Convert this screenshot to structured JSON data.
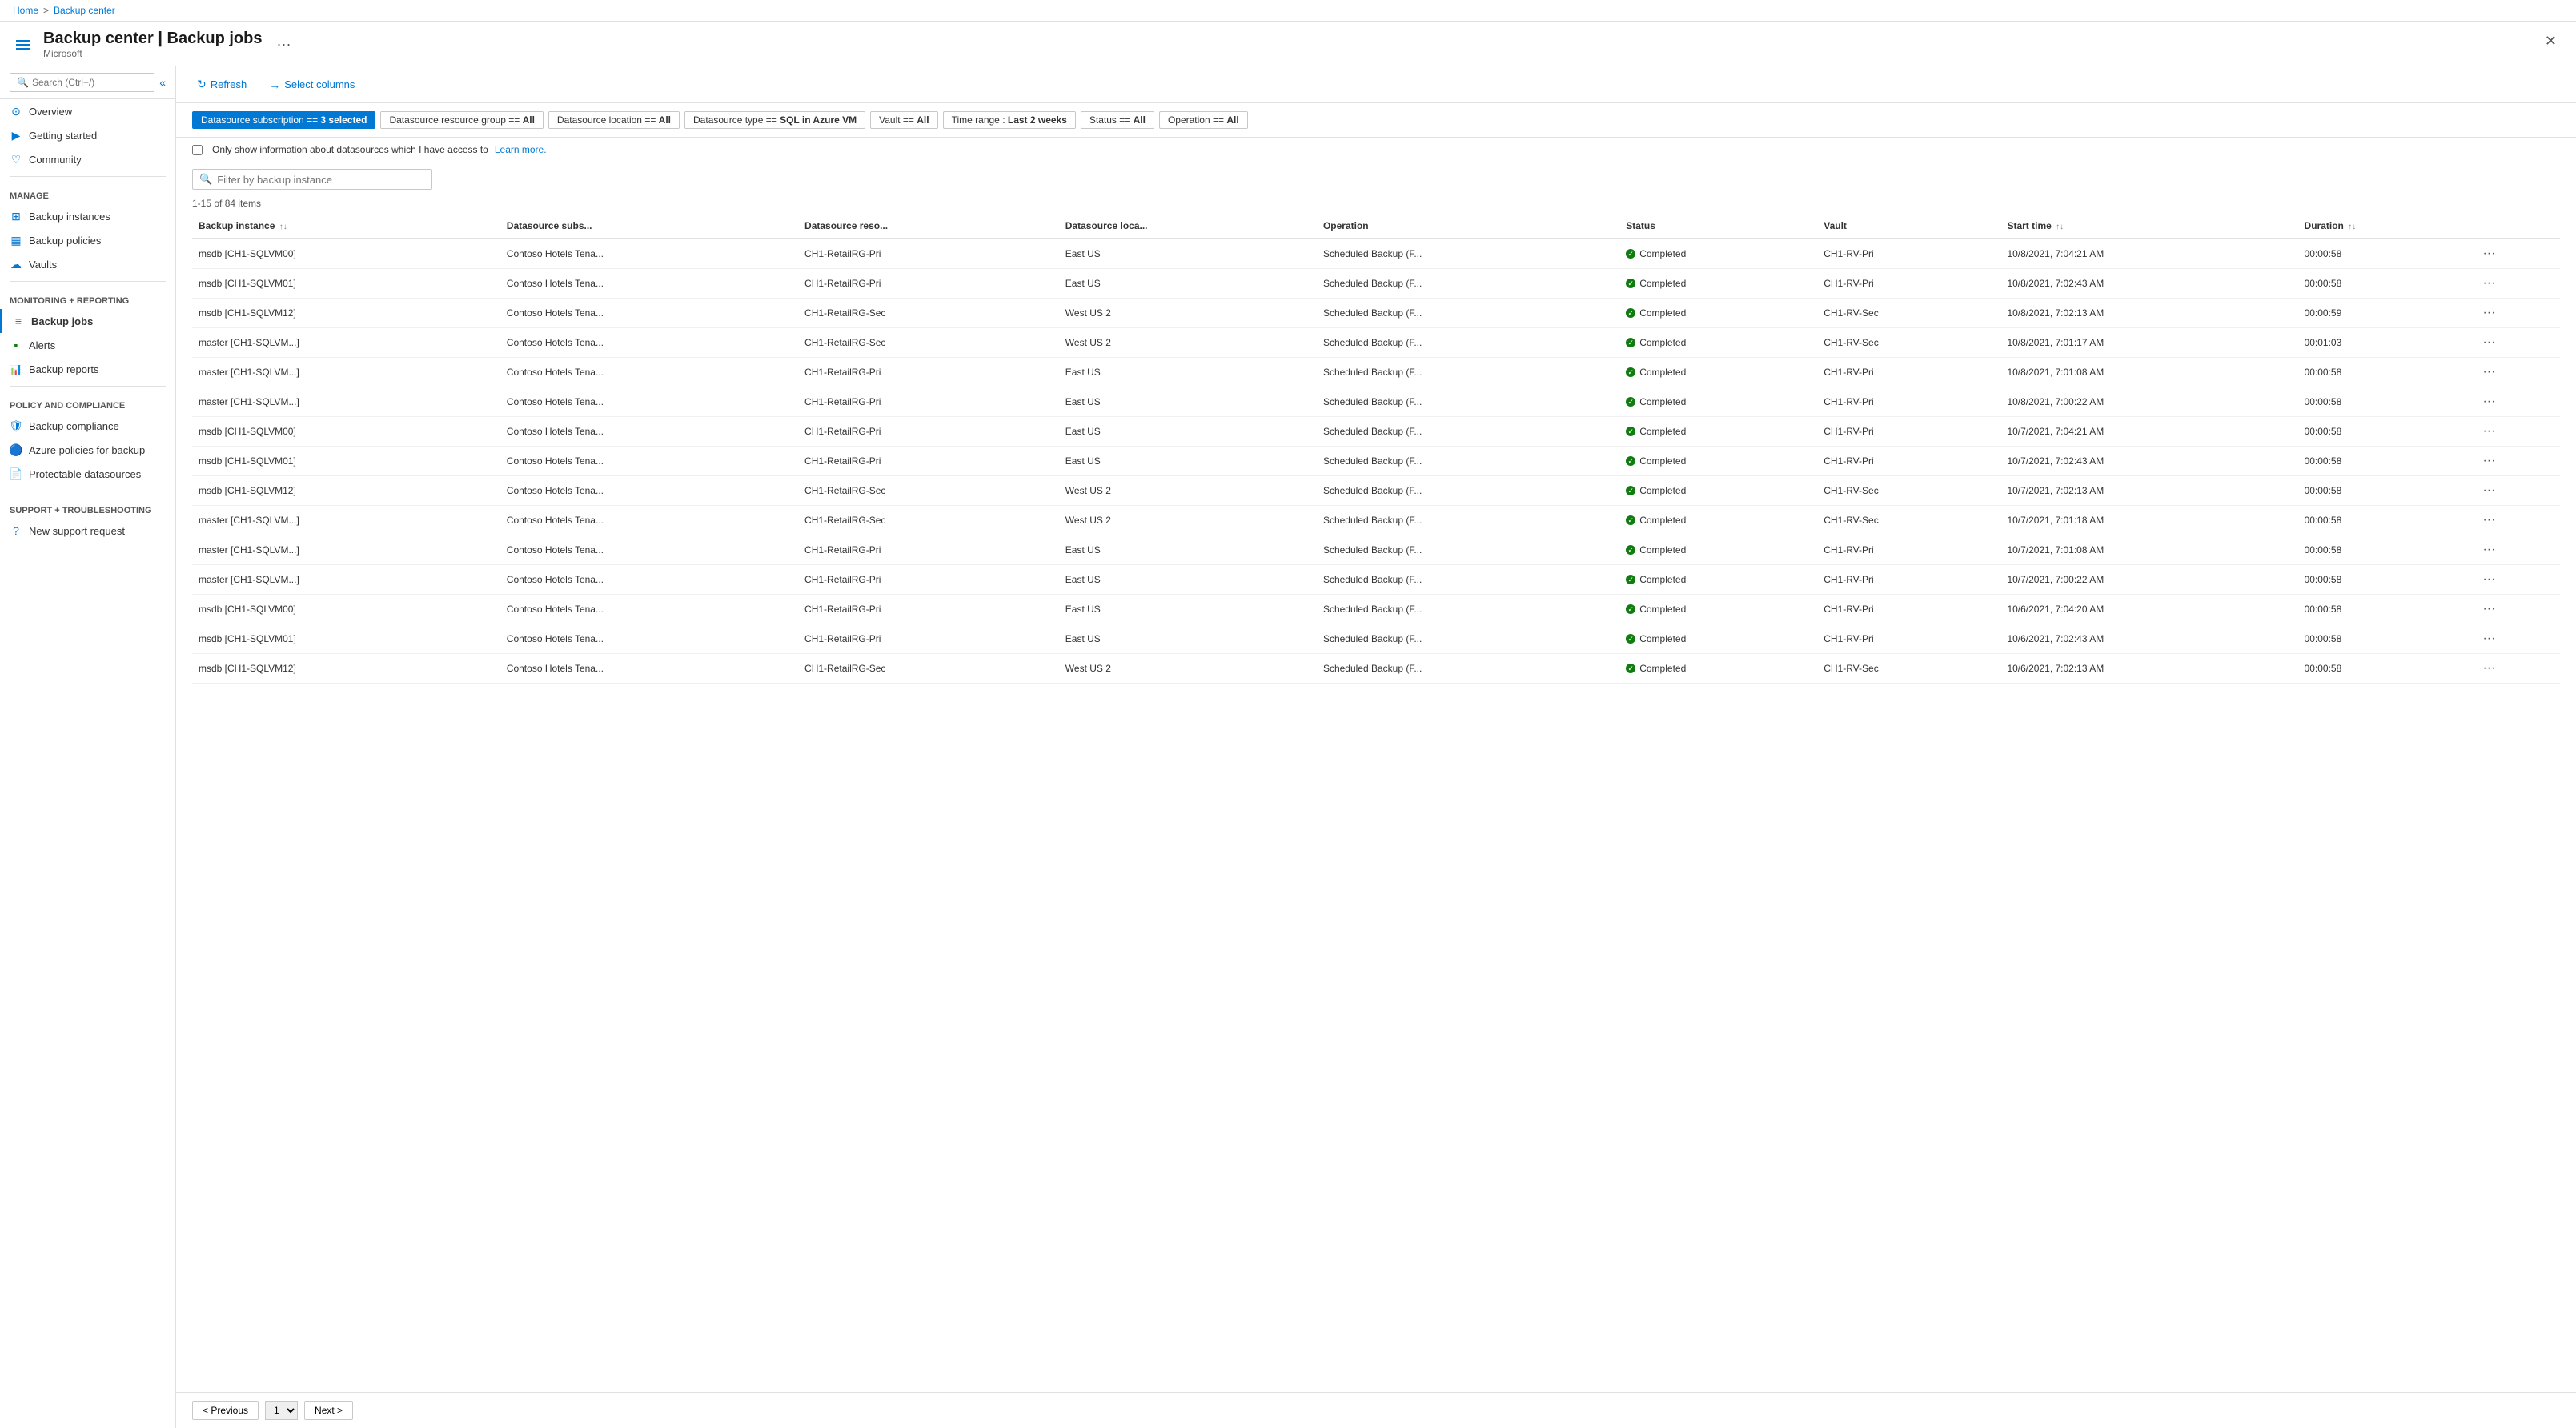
{
  "breadcrumb": {
    "home": "Home",
    "separator": ">",
    "current": "Backup center"
  },
  "header": {
    "title": "Backup center | Backup jobs",
    "subtitle": "Microsoft",
    "more_label": "···",
    "close_label": "✕"
  },
  "sidebar": {
    "search_placeholder": "Search (Ctrl+/)",
    "collapse_label": "«",
    "sections": [
      {
        "items": [
          {
            "id": "overview",
            "label": "Overview",
            "icon": "⊙",
            "color": "#0078d4"
          },
          {
            "id": "getting-started",
            "label": "Getting started",
            "icon": "▶",
            "color": "#0078d4"
          },
          {
            "id": "community",
            "label": "Community",
            "icon": "♡",
            "color": "#0078d4"
          }
        ]
      }
    ],
    "manage_label": "Manage",
    "manage_items": [
      {
        "id": "backup-instances",
        "label": "Backup instances",
        "icon": "⊞",
        "color": "#0078d4"
      },
      {
        "id": "backup-policies",
        "label": "Backup policies",
        "icon": "▦",
        "color": "#0078d4"
      },
      {
        "id": "vaults",
        "label": "Vaults",
        "icon": "☁",
        "color": "#0078d4"
      }
    ],
    "monitoring_label": "Monitoring + reporting",
    "monitoring_items": [
      {
        "id": "backup-jobs",
        "label": "Backup jobs",
        "icon": "≡",
        "color": "#0078d4",
        "active": true
      },
      {
        "id": "alerts",
        "label": "Alerts",
        "icon": "▪",
        "color": "#107c10"
      },
      {
        "id": "backup-reports",
        "label": "Backup reports",
        "icon": "📊",
        "color": "#0078d4"
      }
    ],
    "policy_label": "Policy and compliance",
    "policy_items": [
      {
        "id": "backup-compliance",
        "label": "Backup compliance",
        "icon": "🛡",
        "color": "#0078d4"
      },
      {
        "id": "azure-policies",
        "label": "Azure policies for backup",
        "icon": "🔵",
        "color": "#0078d4"
      },
      {
        "id": "protectable-datasources",
        "label": "Protectable datasources",
        "icon": "📄",
        "color": "#0078d4"
      }
    ],
    "support_label": "Support + troubleshooting",
    "support_items": [
      {
        "id": "new-support-request",
        "label": "New support request",
        "icon": "?",
        "color": "#0078d4"
      }
    ]
  },
  "toolbar": {
    "refresh_label": "Refresh",
    "select_columns_label": "Select columns"
  },
  "filters": {
    "chips": [
      {
        "id": "subscription",
        "label": "Datasource subscription == 3 selected",
        "active": true
      },
      {
        "id": "resource-group",
        "label": "Datasource resource group == All",
        "active": false
      },
      {
        "id": "location",
        "label": "Datasource location == All",
        "active": false
      },
      {
        "id": "type",
        "label": "Datasource type == SQL in Azure VM",
        "active": false
      },
      {
        "id": "vault",
        "label": "Vault == All",
        "active": false
      },
      {
        "id": "time-range",
        "label": "Time range : Last 2 weeks",
        "active": false
      },
      {
        "id": "status",
        "label": "Status == All",
        "active": false
      },
      {
        "id": "operation",
        "label": "Operation == All",
        "active": false
      }
    ]
  },
  "info_bar": {
    "checkbox_label": "Only show information about datasources which I have access to",
    "learn_more": "Learn more."
  },
  "search": {
    "placeholder": "Filter by backup instance"
  },
  "table": {
    "items_count": "1-15 of 84 items",
    "columns": [
      {
        "id": "backup-instance",
        "label": "Backup instance",
        "sortable": true
      },
      {
        "id": "datasource-subs",
        "label": "Datasource subs...",
        "sortable": false
      },
      {
        "id": "datasource-reso",
        "label": "Datasource reso...",
        "sortable": false
      },
      {
        "id": "datasource-loca",
        "label": "Datasource loca...",
        "sortable": false
      },
      {
        "id": "operation",
        "label": "Operation",
        "sortable": false
      },
      {
        "id": "status",
        "label": "Status",
        "sortable": false
      },
      {
        "id": "vault",
        "label": "Vault",
        "sortable": false
      },
      {
        "id": "start-time",
        "label": "Start time",
        "sortable": true
      },
      {
        "id": "duration",
        "label": "Duration",
        "sortable": true
      },
      {
        "id": "actions",
        "label": "",
        "sortable": false
      }
    ],
    "rows": [
      {
        "backup_instance": "msdb [CH1-SQLVM00]",
        "datasource_subs": "Contoso Hotels Tena...",
        "datasource_reso": "CH1-RetailRG-Pri",
        "datasource_loca": "East US",
        "operation": "Scheduled Backup (F...",
        "status": "Completed",
        "vault": "CH1-RV-Pri",
        "start_time": "10/8/2021, 7:04:21 AM",
        "duration": "00:00:58"
      },
      {
        "backup_instance": "msdb [CH1-SQLVM01]",
        "datasource_subs": "Contoso Hotels Tena...",
        "datasource_reso": "CH1-RetailRG-Pri",
        "datasource_loca": "East US",
        "operation": "Scheduled Backup (F...",
        "status": "Completed",
        "vault": "CH1-RV-Pri",
        "start_time": "10/8/2021, 7:02:43 AM",
        "duration": "00:00:58"
      },
      {
        "backup_instance": "msdb [CH1-SQLVM12]",
        "datasource_subs": "Contoso Hotels Tena...",
        "datasource_reso": "CH1-RetailRG-Sec",
        "datasource_loca": "West US 2",
        "operation": "Scheduled Backup (F...",
        "status": "Completed",
        "vault": "CH1-RV-Sec",
        "start_time": "10/8/2021, 7:02:13 AM",
        "duration": "00:00:59"
      },
      {
        "backup_instance": "master [CH1-SQLVM...]",
        "datasource_subs": "Contoso Hotels Tena...",
        "datasource_reso": "CH1-RetailRG-Sec",
        "datasource_loca": "West US 2",
        "operation": "Scheduled Backup (F...",
        "status": "Completed",
        "vault": "CH1-RV-Sec",
        "start_time": "10/8/2021, 7:01:17 AM",
        "duration": "00:01:03"
      },
      {
        "backup_instance": "master [CH1-SQLVM...]",
        "datasource_subs": "Contoso Hotels Tena...",
        "datasource_reso": "CH1-RetailRG-Pri",
        "datasource_loca": "East US",
        "operation": "Scheduled Backup (F...",
        "status": "Completed",
        "vault": "CH1-RV-Pri",
        "start_time": "10/8/2021, 7:01:08 AM",
        "duration": "00:00:58"
      },
      {
        "backup_instance": "master [CH1-SQLVM...]",
        "datasource_subs": "Contoso Hotels Tena...",
        "datasource_reso": "CH1-RetailRG-Pri",
        "datasource_loca": "East US",
        "operation": "Scheduled Backup (F...",
        "status": "Completed",
        "vault": "CH1-RV-Pri",
        "start_time": "10/8/2021, 7:00:22 AM",
        "duration": "00:00:58"
      },
      {
        "backup_instance": "msdb [CH1-SQLVM00]",
        "datasource_subs": "Contoso Hotels Tena...",
        "datasource_reso": "CH1-RetailRG-Pri",
        "datasource_loca": "East US",
        "operation": "Scheduled Backup (F...",
        "status": "Completed",
        "vault": "CH1-RV-Pri",
        "start_time": "10/7/2021, 7:04:21 AM",
        "duration": "00:00:58"
      },
      {
        "backup_instance": "msdb [CH1-SQLVM01]",
        "datasource_subs": "Contoso Hotels Tena...",
        "datasource_reso": "CH1-RetailRG-Pri",
        "datasource_loca": "East US",
        "operation": "Scheduled Backup (F...",
        "status": "Completed",
        "vault": "CH1-RV-Pri",
        "start_time": "10/7/2021, 7:02:43 AM",
        "duration": "00:00:58"
      },
      {
        "backup_instance": "msdb [CH1-SQLVM12]",
        "datasource_subs": "Contoso Hotels Tena...",
        "datasource_reso": "CH1-RetailRG-Sec",
        "datasource_loca": "West US 2",
        "operation": "Scheduled Backup (F...",
        "status": "Completed",
        "vault": "CH1-RV-Sec",
        "start_time": "10/7/2021, 7:02:13 AM",
        "duration": "00:00:58"
      },
      {
        "backup_instance": "master [CH1-SQLVM...]",
        "datasource_subs": "Contoso Hotels Tena...",
        "datasource_reso": "CH1-RetailRG-Sec",
        "datasource_loca": "West US 2",
        "operation": "Scheduled Backup (F...",
        "status": "Completed",
        "vault": "CH1-RV-Sec",
        "start_time": "10/7/2021, 7:01:18 AM",
        "duration": "00:00:58"
      },
      {
        "backup_instance": "master [CH1-SQLVM...]",
        "datasource_subs": "Contoso Hotels Tena...",
        "datasource_reso": "CH1-RetailRG-Pri",
        "datasource_loca": "East US",
        "operation": "Scheduled Backup (F...",
        "status": "Completed",
        "vault": "CH1-RV-Pri",
        "start_time": "10/7/2021, 7:01:08 AM",
        "duration": "00:00:58"
      },
      {
        "backup_instance": "master [CH1-SQLVM...]",
        "datasource_subs": "Contoso Hotels Tena...",
        "datasource_reso": "CH1-RetailRG-Pri",
        "datasource_loca": "East US",
        "operation": "Scheduled Backup (F...",
        "status": "Completed",
        "vault": "CH1-RV-Pri",
        "start_time": "10/7/2021, 7:00:22 AM",
        "duration": "00:00:58"
      },
      {
        "backup_instance": "msdb [CH1-SQLVM00]",
        "datasource_subs": "Contoso Hotels Tena...",
        "datasource_reso": "CH1-RetailRG-Pri",
        "datasource_loca": "East US",
        "operation": "Scheduled Backup (F...",
        "status": "Completed",
        "vault": "CH1-RV-Pri",
        "start_time": "10/6/2021, 7:04:20 AM",
        "duration": "00:00:58"
      },
      {
        "backup_instance": "msdb [CH1-SQLVM01]",
        "datasource_subs": "Contoso Hotels Tena...",
        "datasource_reso": "CH1-RetailRG-Pri",
        "datasource_loca": "East US",
        "operation": "Scheduled Backup (F...",
        "status": "Completed",
        "vault": "CH1-RV-Pri",
        "start_time": "10/6/2021, 7:02:43 AM",
        "duration": "00:00:58"
      },
      {
        "backup_instance": "msdb [CH1-SQLVM12]",
        "datasource_subs": "Contoso Hotels Tena...",
        "datasource_reso": "CH1-RetailRG-Sec",
        "datasource_loca": "West US 2",
        "operation": "Scheduled Backup (F...",
        "status": "Completed",
        "vault": "CH1-RV-Sec",
        "start_time": "10/6/2021, 7:02:13 AM",
        "duration": "00:00:58"
      }
    ]
  },
  "pagination": {
    "prev_label": "< Previous",
    "next_label": "Next >",
    "page_number": "1"
  }
}
